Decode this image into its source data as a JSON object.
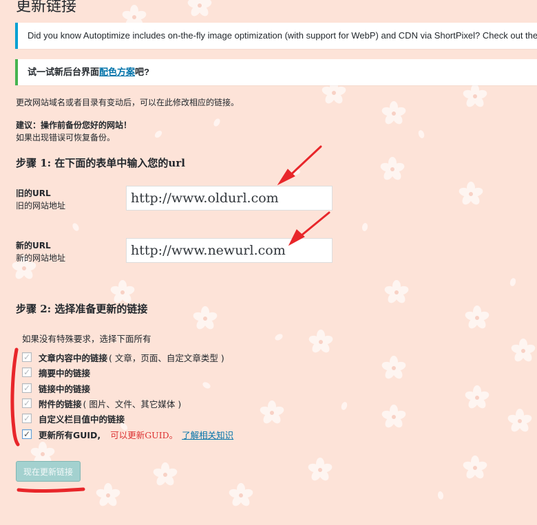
{
  "page": {
    "title": "更新链接"
  },
  "notices": {
    "info": "Did you know Autoptimize includes on-the-fly image optimization (with support for WebP) and CDN via ShortPixel? Check out the",
    "success_prefix": "试一试新后台界面",
    "success_link": "配色方案",
    "success_suffix": "吧?"
  },
  "intro": {
    "description": "更改网站域名或者目录有变动后，可以在此修改相应的链接。",
    "advice": "建议：操作前备份您好的网站！",
    "restore": "如果出现错误可恢复备份。"
  },
  "step1": {
    "heading": "步骤 1: 在下面的表单中输入您的url",
    "old_label": "旧的URL",
    "old_sublabel": "旧的网站地址",
    "old_value": "http://www.oldurl.com",
    "new_label": "新的URL",
    "new_sublabel": "新的网站地址",
    "new_value": "http://www.newurl.com"
  },
  "step2": {
    "heading": "步骤 2: 选择准备更新的链接",
    "hint": "如果没有特殊要求，选择下面所有",
    "options": [
      {
        "label": "文章内容中的链接",
        "note": "( 文章，页面、自定文章类型 )",
        "checked": true
      },
      {
        "label": "摘要中的链接",
        "note": "",
        "checked": true
      },
      {
        "label": "链接中的链接",
        "note": "",
        "checked": true
      },
      {
        "label": "附件的链接",
        "note": "( 图片、文件、其它媒体 )",
        "checked": true
      },
      {
        "label": "自定义栏目值中的链接",
        "note": "",
        "checked": true
      },
      {
        "label": "更新所有GUID,",
        "note": "",
        "checked": true
      }
    ],
    "guid_warning": "可以更新GUID。",
    "guid_link": "了解相关知识"
  },
  "submit_label": "现在更新链接",
  "colors": {
    "background": "#fde3d8",
    "flower": "#ffffff",
    "info_border": "#00a0d2",
    "success_border": "#46b450",
    "annotation": "#e8262a",
    "button": "#a3d1cf",
    "link": "#0073aa",
    "warning": "#dc3232"
  }
}
